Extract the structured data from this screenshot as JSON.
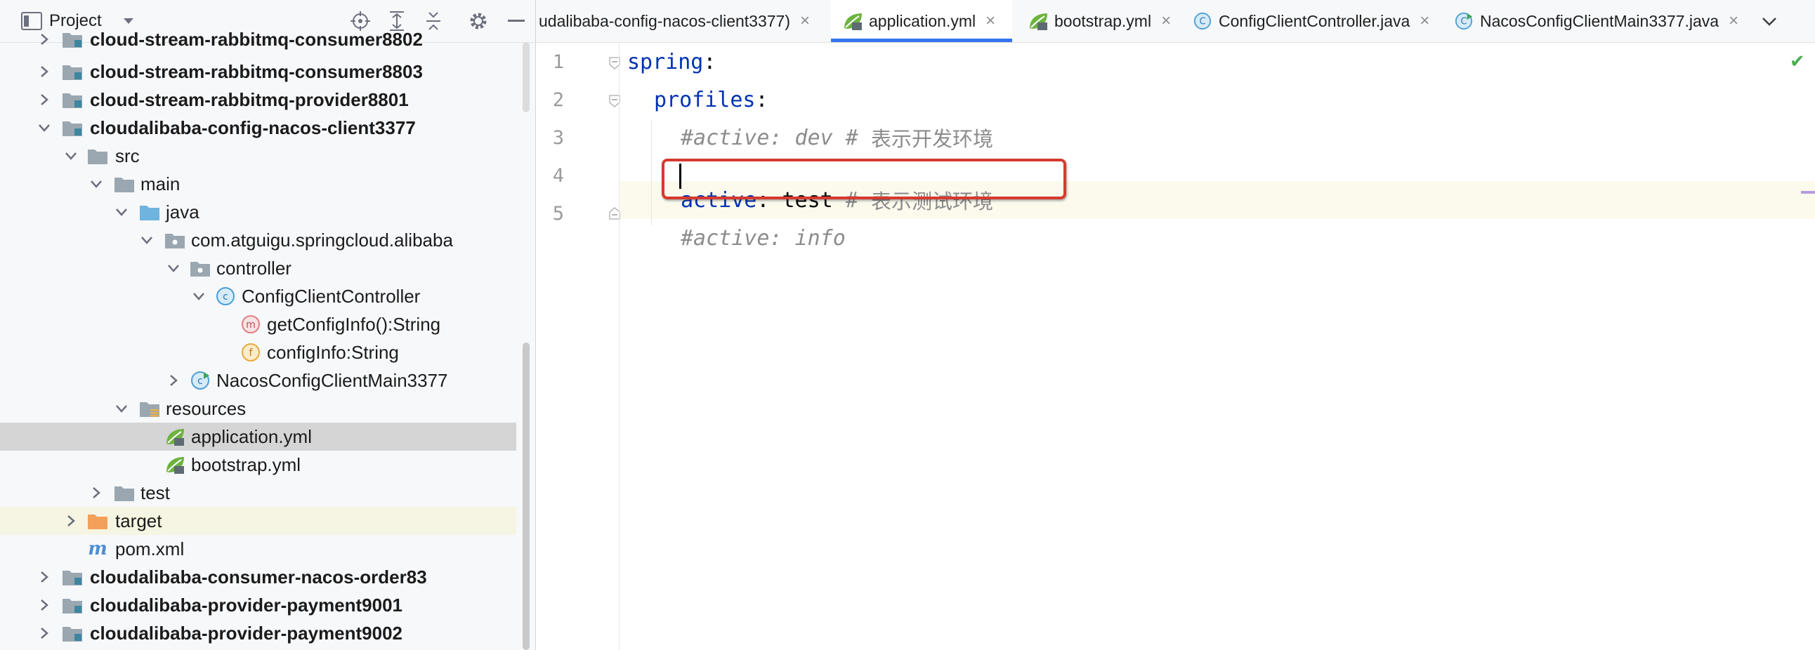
{
  "project_panel": {
    "title": "Project",
    "tree": [
      {
        "label": "cloud-stream-rabbitmq-consumer8802",
        "bold": true
      },
      {
        "label": "cloud-stream-rabbitmq-consumer8803",
        "bold": true
      },
      {
        "label": "cloud-stream-rabbitmq-provider8801",
        "bold": true
      },
      {
        "label": "cloudalibaba-config-nacos-client3377",
        "bold": true
      },
      {
        "label": "src"
      },
      {
        "label": "main"
      },
      {
        "label": "java"
      },
      {
        "label": "com.atguigu.springcloud.alibaba"
      },
      {
        "label": "controller"
      },
      {
        "label": "ConfigClientController"
      },
      {
        "label": "getConfigInfo():String"
      },
      {
        "label": "configInfo:String"
      },
      {
        "label": "NacosConfigClientMain3377"
      },
      {
        "label": "resources"
      },
      {
        "label": "application.yml",
        "selected": true
      },
      {
        "label": "bootstrap.yml"
      },
      {
        "label": "test"
      },
      {
        "label": "target"
      },
      {
        "label": "pom.xml"
      },
      {
        "label": "cloudalibaba-consumer-nacos-order83",
        "bold": true
      },
      {
        "label": "cloudalibaba-provider-payment9001",
        "bold": true
      },
      {
        "label": "cloudalibaba-provider-payment9002",
        "bold": true
      }
    ],
    "icon_letters": {
      "class": "c",
      "method": "m",
      "field": "f",
      "maven": "m"
    }
  },
  "tabs": [
    {
      "label": "udalibaba-config-nacos-client3377)",
      "close": "×"
    },
    {
      "label": "application.yml",
      "close": "×",
      "active": true
    },
    {
      "label": "bootstrap.yml",
      "close": "×"
    },
    {
      "label": "ConfigClientController.java",
      "close": "×"
    },
    {
      "label": "NacosConfigClientMain3377.java",
      "close": "×"
    }
  ],
  "tab_icon_letter": "C",
  "editor": {
    "line_numbers": [
      "1",
      "2",
      "3",
      "4",
      "5"
    ],
    "lines": [
      {
        "key": "spring",
        "punc": ":"
      },
      {
        "key": "profiles",
        "punc": ":"
      },
      {
        "comment": "#active: dev # ",
        "cjk": "表示开发环境"
      },
      {
        "key": "active",
        "punc": ": ",
        "value": "test",
        "comment": " # ",
        "cjk": "表示测试环境"
      },
      {
        "comment": "#active: info"
      }
    ],
    "status_icon": "check-icon"
  },
  "colors": {
    "accent": "#3574f0",
    "highlight_border": "#d63a2f",
    "yaml_key": "#0033b3",
    "comment": "#8c8c8c",
    "folder": "#9aa7b0",
    "source_folder": "#6fb3df",
    "excluded_folder": "#f4a05a"
  }
}
